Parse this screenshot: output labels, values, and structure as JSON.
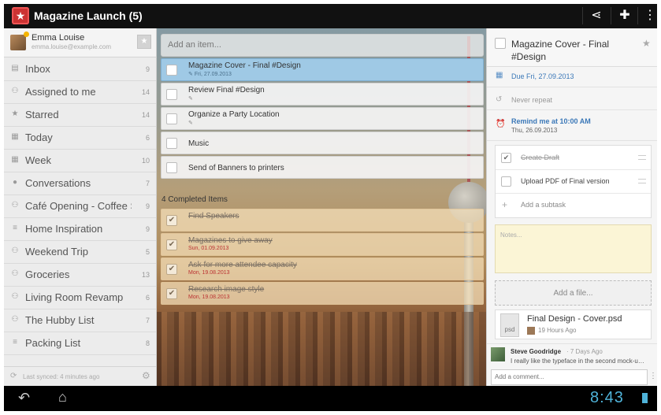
{
  "app": {
    "title": "Magazine Launch (5)"
  },
  "toolbar": {
    "share_icon": "share-icon",
    "add_person_icon": "add-person-icon",
    "overflow_icon": "overflow-menu-icon"
  },
  "profile": {
    "name": "Emma Louise",
    "email": "emma.louise@example.com"
  },
  "sidebar": {
    "items": [
      {
        "label": "Inbox",
        "count": "9",
        "icon": "inbox-icon",
        "glyph": "▤"
      },
      {
        "label": "Assigned to me",
        "count": "14",
        "icon": "assigned-icon",
        "glyph": "⚇"
      },
      {
        "label": "Starred",
        "count": "14",
        "icon": "star-icon",
        "glyph": "★"
      },
      {
        "label": "Today",
        "count": "6",
        "icon": "calendar-icon",
        "glyph": "▦"
      },
      {
        "label": "Week",
        "count": "10",
        "icon": "calendar-week-icon",
        "glyph": "▦"
      },
      {
        "label": "Conversations",
        "count": "7",
        "icon": "chat-bubble-icon",
        "glyph": "●"
      },
      {
        "label": "Café Opening - Coffee S…",
        "count": "9",
        "icon": "shared-list-icon",
        "glyph": "⚇"
      },
      {
        "label": "Home Inspiration",
        "count": "9",
        "icon": "list-icon",
        "glyph": "≡"
      },
      {
        "label": "Weekend Trip",
        "count": "5",
        "icon": "shared-list-icon",
        "glyph": "⚇"
      },
      {
        "label": "Groceries",
        "count": "13",
        "icon": "shared-list-icon",
        "glyph": "⚇"
      },
      {
        "label": "Living Room Revamp",
        "count": "6",
        "icon": "shared-list-icon",
        "glyph": "⚇"
      },
      {
        "label": "The Hubby List",
        "count": "7",
        "icon": "shared-list-icon",
        "glyph": "⚇"
      },
      {
        "label": "Packing List",
        "count": "8",
        "icon": "list-icon",
        "glyph": "≡"
      }
    ],
    "sync_text": "Last synced: 4 minutes ago"
  },
  "tasks": {
    "add_placeholder": "Add an item...",
    "open": [
      {
        "title": "Magazine Cover - Final #Design",
        "meta": "Fri, 27.09.2013",
        "selected": true
      },
      {
        "title": "Review Final #Design",
        "meta": ""
      },
      {
        "title": "Organize a Party Location",
        "meta": ""
      },
      {
        "title": "Music",
        "meta": ""
      },
      {
        "title": "Send of Banners to printers",
        "meta": ""
      }
    ],
    "completed_label": "4 Completed Items",
    "completed": [
      {
        "title": "Find Speakers",
        "meta": ""
      },
      {
        "title": "Magazines to give away",
        "meta": "Sun, 01.09.2013"
      },
      {
        "title": "Ask for more attendee capacity",
        "meta": "Mon, 19.08.2013"
      },
      {
        "title": "Research image style",
        "meta": "Mon, 19.08.2013"
      }
    ]
  },
  "detail": {
    "title": "Magazine Cover - Final #Design",
    "due_date": "Due Fri, 27.09.2013",
    "repeat": "Never repeat",
    "reminder": "Remind me at 10:00 AM",
    "reminder_date": "Thu, 26.09.2013",
    "subtasks": [
      {
        "label": "Create Draft",
        "done": true
      },
      {
        "label": "Upload PDF of Final version",
        "done": false
      }
    ],
    "add_subtask": "Add a subtask",
    "notes_placeholder": "Notes...",
    "add_file": "Add a file...",
    "file": {
      "name": "Final Design - Cover.psd",
      "ext": "psd",
      "time": "19 Hours Ago"
    },
    "comment": {
      "author": "Steve Goodridge",
      "time": "· 7 Days Ago",
      "text": "I really like the typeface in the second mock-u…"
    },
    "comment_placeholder": "Add a comment..."
  },
  "system": {
    "time": "8:43"
  }
}
